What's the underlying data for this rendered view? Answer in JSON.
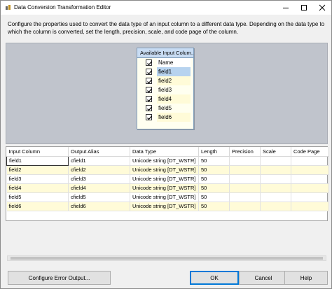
{
  "window": {
    "title": "Data Conversion Transformation Editor"
  },
  "description": "Configure the properties used to convert the data type of an input column to a different data type. Depending on the data type to which the column is converted, set the length, precision, scale, and code page of the column.",
  "available_columns": {
    "header": "Available Input Colum...",
    "name_label": "Name",
    "items": [
      "field1",
      "field2",
      "field3",
      "field4",
      "field5",
      "field6"
    ]
  },
  "grid": {
    "headers": [
      "Input Column",
      "Output Alias",
      "Data Type",
      "Length",
      "Precision",
      "Scale",
      "Code Page"
    ],
    "rows": [
      [
        "field1",
        "cfield1",
        "Unicode string [DT_WSTR]",
        "50",
        "",
        "",
        ""
      ],
      [
        "field2",
        "cfield2",
        "Unicode string [DT_WSTR]",
        "50",
        "",
        "",
        ""
      ],
      [
        "field3",
        "cfield3",
        "Unicode string [DT_WSTR]",
        "50",
        "",
        "",
        ""
      ],
      [
        "field4",
        "cfield4",
        "Unicode string [DT_WSTR]",
        "50",
        "",
        "",
        ""
      ],
      [
        "field5",
        "cfield5",
        "Unicode string [DT_WSTR]",
        "50",
        "",
        "",
        ""
      ],
      [
        "field6",
        "cfield6",
        "Unicode string [DT_WSTR]",
        "50",
        "",
        "",
        ""
      ]
    ]
  },
  "buttons": {
    "config_error_output": "Configure Error Output...",
    "ok": "OK",
    "cancel": "Cancel",
    "help": "Help"
  }
}
